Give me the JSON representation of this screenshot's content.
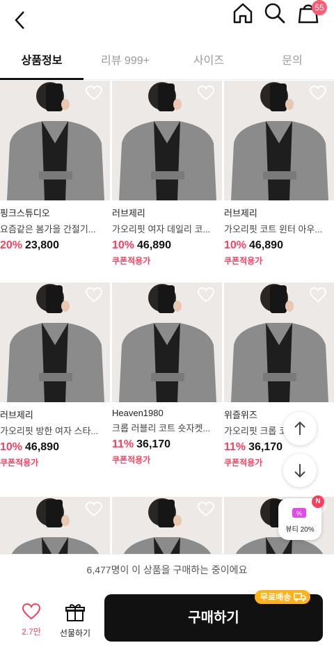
{
  "header": {
    "back_icon": "chevron-left-icon",
    "home_icon": "home-icon",
    "search_icon": "search-icon",
    "cart_icon": "shopping-bag-icon",
    "cart_count": "55"
  },
  "tabs": [
    {
      "label": "상품정보",
      "active": true
    },
    {
      "label": "리뷰 999+",
      "active": false
    },
    {
      "label": "사이즈",
      "active": false
    },
    {
      "label": "문의",
      "active": false
    }
  ],
  "products": [
    {
      "brand": "핑크스튜디오",
      "name": "요즘같은 봄가을 간절기...",
      "discount": "20%",
      "price": "23,800",
      "coupon": ""
    },
    {
      "brand": "러브제리",
      "name": "가오리핏 여자 데일리 코...",
      "discount": "10%",
      "price": "46,890",
      "coupon": "쿠폰적용가"
    },
    {
      "brand": "러브제리",
      "name": "가오리핏 코트 윈터 아우...",
      "discount": "10%",
      "price": "46,890",
      "coupon": "쿠폰적용가"
    },
    {
      "brand": "러브제리",
      "name": "가오리핏 방한 여자 스타...",
      "discount": "10%",
      "price": "46,890",
      "coupon": "쿠폰적용가"
    },
    {
      "brand": "Heaven1980",
      "name": "크롭 러블리 코트 숏자켓...",
      "discount": "11%",
      "price": "36,170",
      "coupon": "쿠폰적용가"
    },
    {
      "brand": "위즐위즈",
      "name": "가오리핏 크롭 코트 블...",
      "discount": "11%",
      "price": "36,170",
      "coupon": "쿠폰적용가"
    },
    {
      "brand": "",
      "name": "",
      "discount": "",
      "price": "",
      "coupon": ""
    },
    {
      "brand": "",
      "name": "",
      "discount": "",
      "price": "",
      "coupon": ""
    },
    {
      "brand": "",
      "name": "",
      "discount": "",
      "price": "",
      "coupon": ""
    }
  ],
  "floating": {
    "scroll_up_icon": "arrow-up-icon",
    "scroll_down_icon": "arrow-down-icon",
    "beauty_badge": "N",
    "beauty_label": "뷰티 20%"
  },
  "notice": "6,477명이 이 상품을 구매하는 중이에요",
  "bottom": {
    "like_count": "2.7만",
    "gift_label": "선물하기",
    "buy_label": "구매하기",
    "free_shipping": "무료배송"
  },
  "colors": {
    "accent": "#ff3d5e",
    "buy_button": "#111111",
    "free_ship": "#ffb21a"
  }
}
